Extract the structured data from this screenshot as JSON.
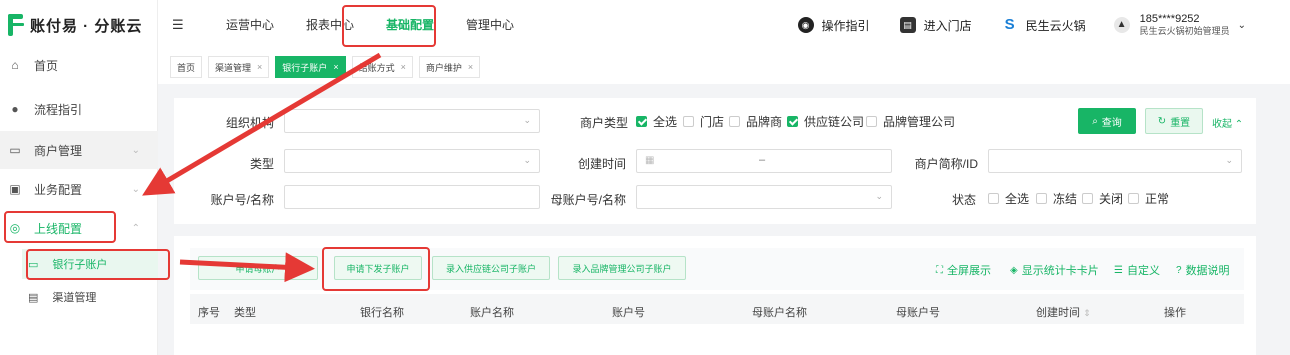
{
  "brand": {
    "name": "账付易 · 分账云"
  },
  "sidebar": {
    "items": [
      {
        "label": "首页",
        "icon": "home-icon",
        "glyph": "⌂"
      },
      {
        "label": "流程指引",
        "icon": "bulb-icon",
        "glyph": "●"
      },
      {
        "label": "商户管理",
        "icon": "merchant-icon",
        "glyph": "▭"
      },
      {
        "label": "业务配置",
        "icon": "business-icon",
        "glyph": "▣"
      },
      {
        "label": "上线配置",
        "icon": "launch-icon",
        "glyph": "◎"
      }
    ],
    "subitems": [
      {
        "label": "银行子账户",
        "icon": "card-icon",
        "glyph": "▭"
      },
      {
        "label": "渠道管理",
        "icon": "doc-icon",
        "glyph": "▤"
      }
    ]
  },
  "topnav": {
    "items": [
      "运营中心",
      "报表中心",
      "基础配置",
      "管理中心"
    ],
    "active": "基础配置"
  },
  "tools": {
    "guide": "操作指引",
    "store": "进入门店",
    "tenant": "民生云火锅"
  },
  "user": {
    "phone": "185****9252",
    "role": "民生云火锅初始管理员"
  },
  "tabs": [
    {
      "label": "首页",
      "close": ""
    },
    {
      "label": "渠道管理",
      "close": "×"
    },
    {
      "label": "银行子账户",
      "close": "×"
    },
    {
      "label": "结账方式",
      "close": "×"
    },
    {
      "label": "商户维护",
      "close": "×"
    }
  ],
  "filters": {
    "org_label": "组织机构",
    "merchant_type_label": "商户类型",
    "merchant_types": [
      {
        "label": "全选",
        "checked": true
      },
      {
        "label": "门店",
        "checked": false
      },
      {
        "label": "品牌商",
        "checked": false
      },
      {
        "label": "供应链公司",
        "checked": true
      },
      {
        "label": "品牌管理公司",
        "checked": false
      }
    ],
    "type_label": "类型",
    "created_label": "创建时间",
    "date_sep": "–",
    "merchant_short_label": "商户简称/ID",
    "account_label": "账户号/名称",
    "parent_account_label": "母账户号/名称",
    "status_label": "状态",
    "statuses": [
      "全选",
      "冻结",
      "关闭",
      "正常"
    ],
    "search_btn": "查询",
    "reset_btn": "重置",
    "collapse": "收起"
  },
  "actions": {
    "apply_main": "申请母账户",
    "apply_sub": "申请下发子账户",
    "add_supply": "录入供应链公司子账户",
    "add_brand": "录入品牌管理公司子账户",
    "fullscreen": "全屏展示",
    "show_stats": "显示统计卡卡片",
    "custom": "自定义",
    "data_desc": "数据说明"
  },
  "table": {
    "headers": [
      "序号",
      "类型",
      "银行名称",
      "账户名称",
      "账户号",
      "母账户名称",
      "母账户号",
      "创建时间",
      "操作"
    ]
  },
  "colors": {
    "accent": "#18b566",
    "annotation": "#e53935"
  }
}
